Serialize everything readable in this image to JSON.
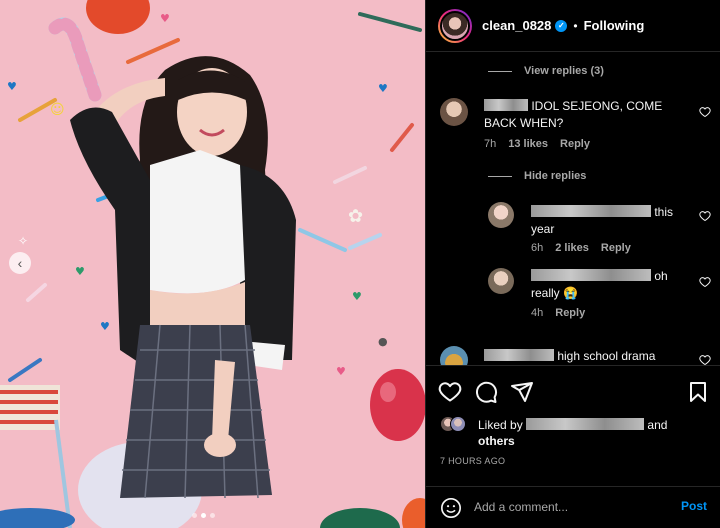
{
  "post": {
    "username": "clean_0828",
    "separator": "•",
    "follow_status": "Following",
    "verified": true
  },
  "comments": {
    "view_replies": "View replies (3)",
    "hide_replies": "Hide replies",
    "items": [
      {
        "text": "IDOL SEJEONG, COME BACK WHEN?",
        "time": "7h",
        "likes": "13 likes",
        "reply": "Reply"
      },
      {
        "text_tail": "this",
        "text_line2": "year",
        "time": "6h",
        "likes": "2 likes",
        "reply": "Reply"
      },
      {
        "text_tail": "oh",
        "text_line2": "really 😭",
        "time": "4h",
        "reply": "Reply"
      },
      {
        "text_tail": "high school drama"
      }
    ]
  },
  "liked_by": {
    "prefix": "Liked by",
    "suffix": "and",
    "others": "others"
  },
  "timestamp": "7 HOURS AGO",
  "composer": {
    "placeholder": "Add a comment...",
    "post_label": "Post"
  },
  "colors": {
    "accent": "#0095f6",
    "background": "#000000",
    "photo_background": "#f3bcc6",
    "secondary_text": "#a8a8a8"
  },
  "icons": {
    "carousel_prev": "‹",
    "verified": "✓"
  }
}
